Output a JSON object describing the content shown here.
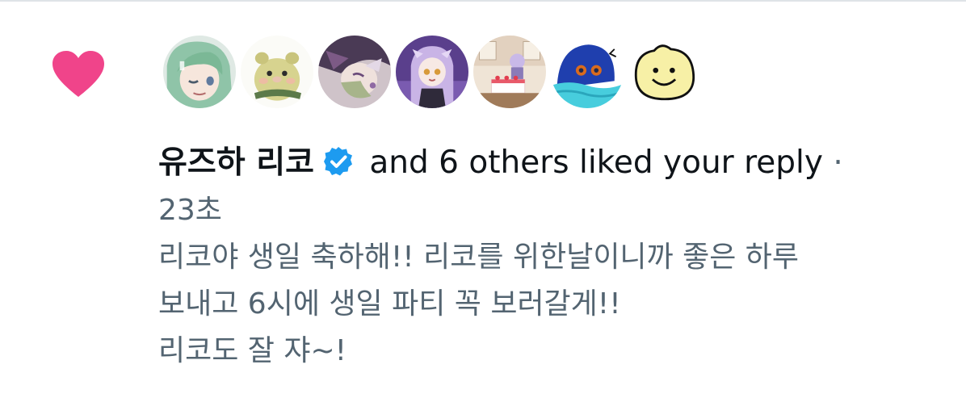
{
  "notification": {
    "type_icon": "heart-icon",
    "heart_color": "#f0448a",
    "avatars": [
      {
        "name": "avatar-green-hair-girl-icon"
      },
      {
        "name": "avatar-hamster-icon"
      },
      {
        "name": "avatar-purple-bow-character-icon"
      },
      {
        "name": "avatar-purple-hair-girl-icon"
      },
      {
        "name": "avatar-birthday-cake-room-icon"
      },
      {
        "name": "avatar-blue-creature-icon"
      },
      {
        "name": "avatar-yellow-smiley-icon"
      }
    ],
    "display_name": "유즈하 리코",
    "verified_icon": "verified-badge-icon",
    "verified_color": "#1d9bf0",
    "action_text": "and 6 others liked your reply",
    "separator": "·",
    "timestamp": "23초",
    "reply_lines": [
      "리코야 생일 축하해!! 리코를 위한날이니까 좋은 하루",
      "보내고 6시에 생일 파티 꼭 보러갈게!!",
      "리코도 잘 쟈~!"
    ]
  }
}
